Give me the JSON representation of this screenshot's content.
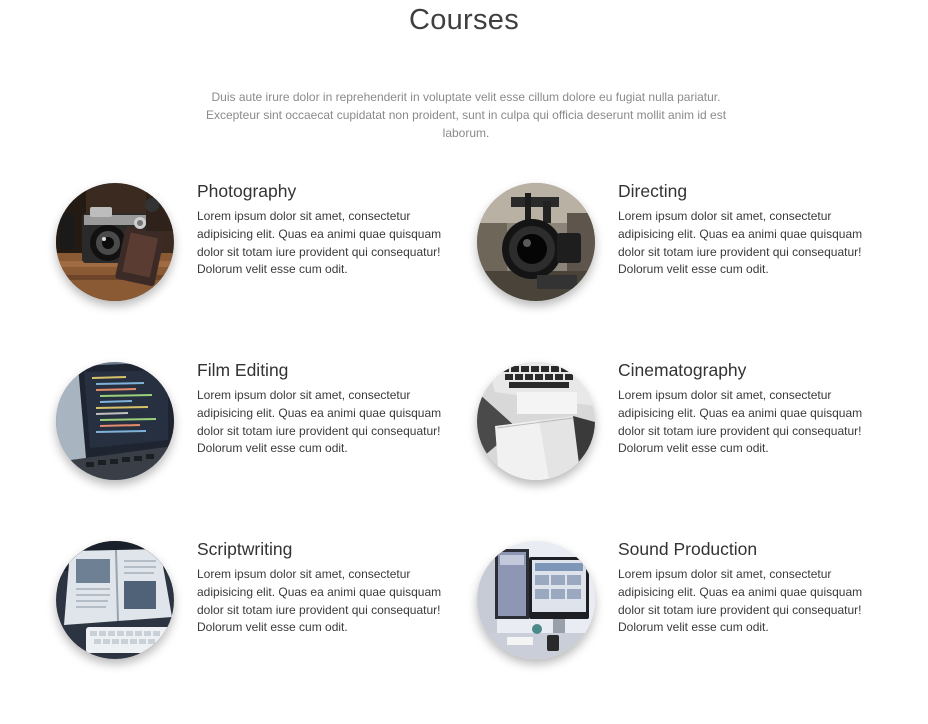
{
  "header": {
    "title": "Courses",
    "intro": "Duis aute irure dolor in reprehenderit in voluptate velit esse cillum dolore eu fugiat nulla pariatur. Excepteur sint occaecat cupidatat non proident, sunt in culpa qui officia deserunt mollit anim id est laborum."
  },
  "courses": [
    {
      "title": "Photography",
      "description": "Lorem ipsum dolor sit amet, consectetur adipisicing elit. Quas ea animi quae quisquam dolor sit totam iure provident qui consequatur! Dolorum velit esse cum odit.",
      "image": "vintage-camera-photo"
    },
    {
      "title": "Directing",
      "description": "Lorem ipsum dolor sit amet, consectetur adipisicing elit. Quas ea animi quae quisquam dolor sit totam iure provident qui consequatur! Dolorum velit esse cum odit.",
      "image": "video-camera-lens-photo"
    },
    {
      "title": "Film Editing",
      "description": "Lorem ipsum dolor sit amet, consectetur adipisicing elit. Quas ea animi quae quisquam dolor sit totam iure provident qui consequatur! Dolorum velit esse cum odit.",
      "image": "laptop-code-screen-photo"
    },
    {
      "title": "Cinematography",
      "description": "Lorem ipsum dolor sit amet, consectetur adipisicing elit. Quas ea animi quae quisquam dolor sit totam iure provident qui consequatur! Dolorum velit esse cum odit.",
      "image": "keyboard-notebook-photo"
    },
    {
      "title": "Scriptwriting",
      "description": "Lorem ipsum dolor sit amet, consectetur adipisicing elit. Quas ea animi quae quisquam dolor sit totam iure provident qui consequatur! Dolorum velit esse cum odit.",
      "image": "open-magazine-keyboard-photo"
    },
    {
      "title": "Sound Production",
      "description": "Lorem ipsum dolor sit amet, consectetur adipisicing elit. Quas ea animi quae quisquam dolor sit totam iure provident qui consequatur! Dolorum velit esse cum odit.",
      "image": "desktop-monitors-photo"
    }
  ]
}
